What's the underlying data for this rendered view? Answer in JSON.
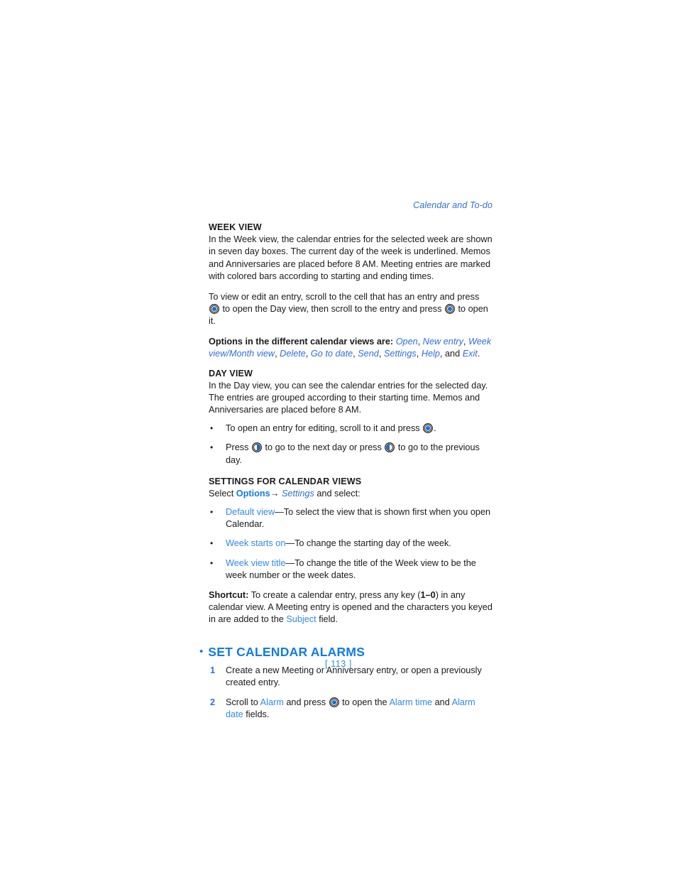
{
  "document": {
    "running_head": "Calendar and To-do",
    "page_number": "[ 113 ]"
  },
  "colors": {
    "running_head_blue": "#2f6fdd",
    "section_heading_blue": "#0f7ce8",
    "inline_link_blue": "#2f8ae8",
    "italic_term_blue": "#2f6fdd",
    "body_text": "#1a1a1a",
    "icon_blue": "#1573d4",
    "icon_ring": "#231f20"
  },
  "icons": {
    "select_key": "scroll-select-key-icon",
    "scroll_right_key": "scroll-right-key-icon",
    "scroll_left_key": "scroll-left-key-icon"
  },
  "sections": {
    "week_view": {
      "heading": "WEEK VIEW",
      "paragraph1": "In the Week view, the calendar entries for the selected week are shown in seven day boxes. The current day of the week is underlined. Memos and Anniversaries are placed before 8 AM. Meeting entries are marked with colored bars according to starting and ending times.",
      "paragraph2_part1": "To view or edit an entry, scroll to the cell that has an entry and press",
      "paragraph2_part2": "to open the Day view, then scroll to the entry and press",
      "paragraph2_part3": "to open it.",
      "options_lead": "Options in the different calendar views are:",
      "options": [
        "Open",
        "New entry",
        "Week view",
        "Month view",
        "Delete",
        "Go to date",
        "Send",
        "Settings",
        "Help",
        "Exit"
      ],
      "options_separator_slash": "/",
      "options_and": "and",
      "options_comma": ",",
      "options_period": "."
    },
    "day_view": {
      "heading": "DAY VIEW",
      "paragraph1": "In the Day view, you can see the calendar entries for the selected day. The entries are grouped according to their starting time. Memos and Anniversaries are placed before 8 AM.",
      "bullets": [
        {
          "marker": "•",
          "text_part1": "To open an entry for editing, scroll to it and press",
          "text_part2": "."
        },
        {
          "marker": "•",
          "text_part1": "Press",
          "text_part2": "to go to the next day or press",
          "text_part3": "to go to the previous day."
        }
      ]
    },
    "settings_for_calendar_views": {
      "heading": "SETTINGS FOR CALENDAR VIEWS",
      "lead_select": "Select",
      "lead_options": "Options",
      "lead_arrow": "→",
      "lead_settings": "Settings",
      "lead_tail": "and select:",
      "bullets": [
        {
          "marker": "•",
          "term": "Default view",
          "description": "—To select the view that is shown first when you open Calendar."
        },
        {
          "marker": "•",
          "term": "Week starts on",
          "description": "—To change the starting day of the week."
        },
        {
          "marker": "•",
          "term": "Week view title",
          "description": "—To change the title of the Week view to be the week number or the week dates."
        }
      ]
    },
    "shortcut": {
      "label": "Shortcut:",
      "text_part1": "To create a calendar entry, press any key (",
      "keys": "1–0",
      "text_part2": ") in any calendar view. A Meeting entry is opened and the characters you keyed in are added to the",
      "field_name": "Subject",
      "text_part3": "field."
    },
    "set_calendar_alarms": {
      "bullet": "•",
      "heading": "SET CALENDAR ALARMS",
      "steps": [
        {
          "number": "1",
          "text": "Create a new Meeting or Anniversary entry, or open a previously created entry."
        },
        {
          "number": "2",
          "text_part1": "Scroll to",
          "term1": "Alarm",
          "text_part2": "and press",
          "text_part3": "to open the",
          "term2": "Alarm time",
          "text_part4": "and",
          "term3": "Alarm date",
          "text_part5": "fields."
        }
      ]
    }
  }
}
